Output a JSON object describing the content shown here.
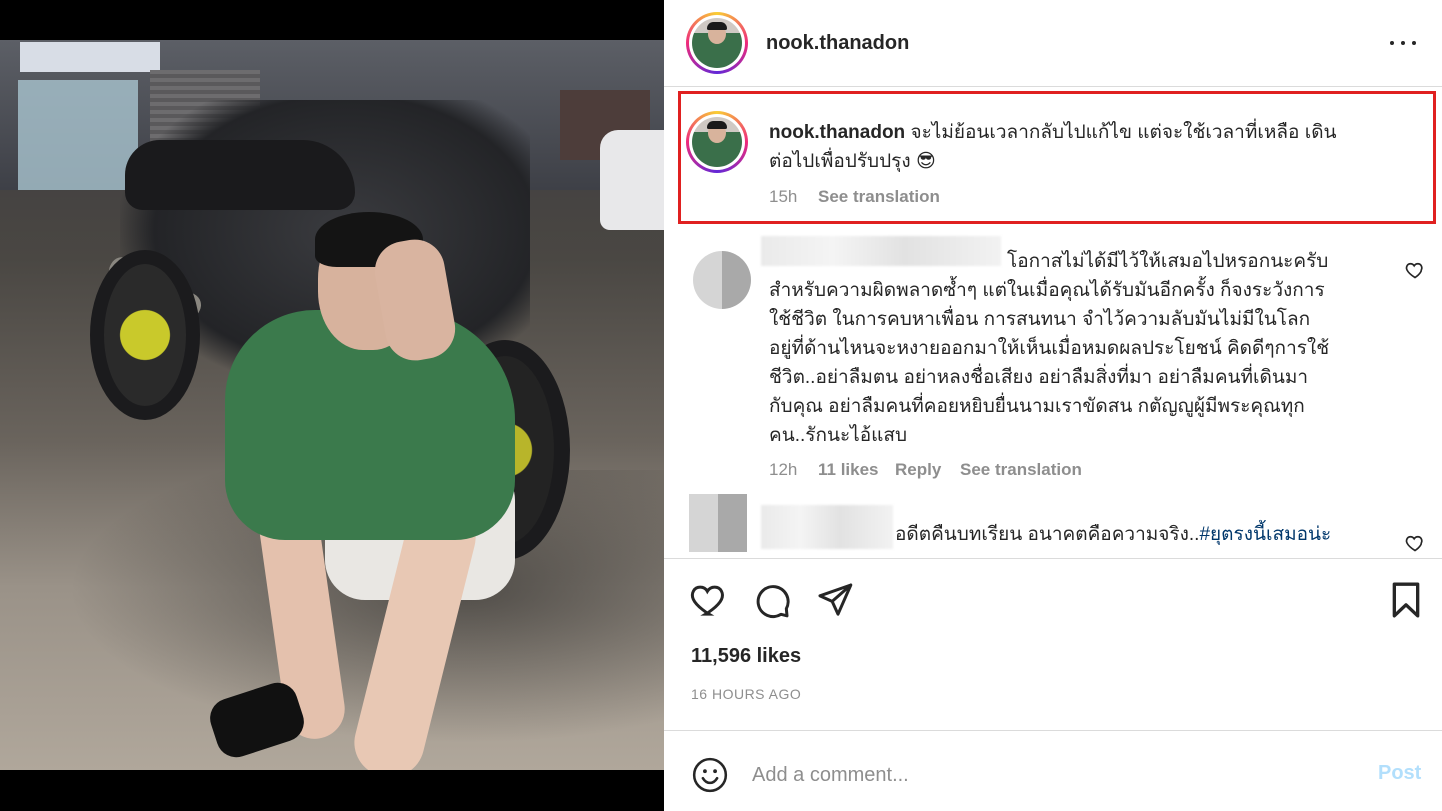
{
  "post": {
    "username": "nook.thanadon",
    "more_label": "More options"
  },
  "caption": {
    "username": "nook.thanadon",
    "text_line1": "จะไม่ย้อนเวลากลับไปแก้ไข แต่จะใช้เวลาที่เหลือ เดิน",
    "text_line2": "ต่อไปเพื่อปรับปรุง",
    "emoji": "😎",
    "time": "15h",
    "see_translation": "See translation"
  },
  "comments": [
    {
      "lines": [
        "โอกาสไม่ได้มีไว้ให้เสมอไปหรอกนะครับ",
        "สำหรับความผิดพลาดซ้ำๆ แต่ในเมื่อคุณได้รับมันอีกครั้ง ก็จงระวังการ",
        "ใช้ชีวิต ในการคบหาเพื่อน การสนทนา จำไว้ความลับมันไม่มีในโลก",
        "อยู่ที่ด้านไหนจะหงายออกมาให้เห็นเมื่อหมดผลประโยชน์ คิดดีๆการใช้",
        "ชีวิต..อย่าลืมตน อย่าหลงชื่อเสียง อย่าลืมสิ่งที่มา อย่าลืมคนที่เดินมา",
        "กับคุณ อย่าลืมคนที่คอยหยิบยื่นนามเราขัดสน กตัญญูผู้มีพระคุณทุก",
        "คน..รักนะไอ้แสบ"
      ],
      "time": "12h",
      "likes": "11 likes",
      "reply": "Reply",
      "see_translation": "See translation"
    },
    {
      "text": "อดีตคืนบทเรียน อนาคตคือความจริง..",
      "hashtag": "#ยุตรงนี้เสมอน่ะ"
    }
  ],
  "actions": {
    "like_icon": "heart-icon",
    "comment_icon": "comment-icon",
    "share_icon": "share-icon",
    "save_icon": "bookmark-icon"
  },
  "likes_count": "11,596 likes",
  "posted_ago": "16 HOURS AGO",
  "comment_box": {
    "placeholder": "Add a comment...",
    "post_label": "Post"
  },
  "colors": {
    "highlight_border": "#e02020",
    "post_button": "#b2dffc",
    "hashtag": "#00376b"
  }
}
